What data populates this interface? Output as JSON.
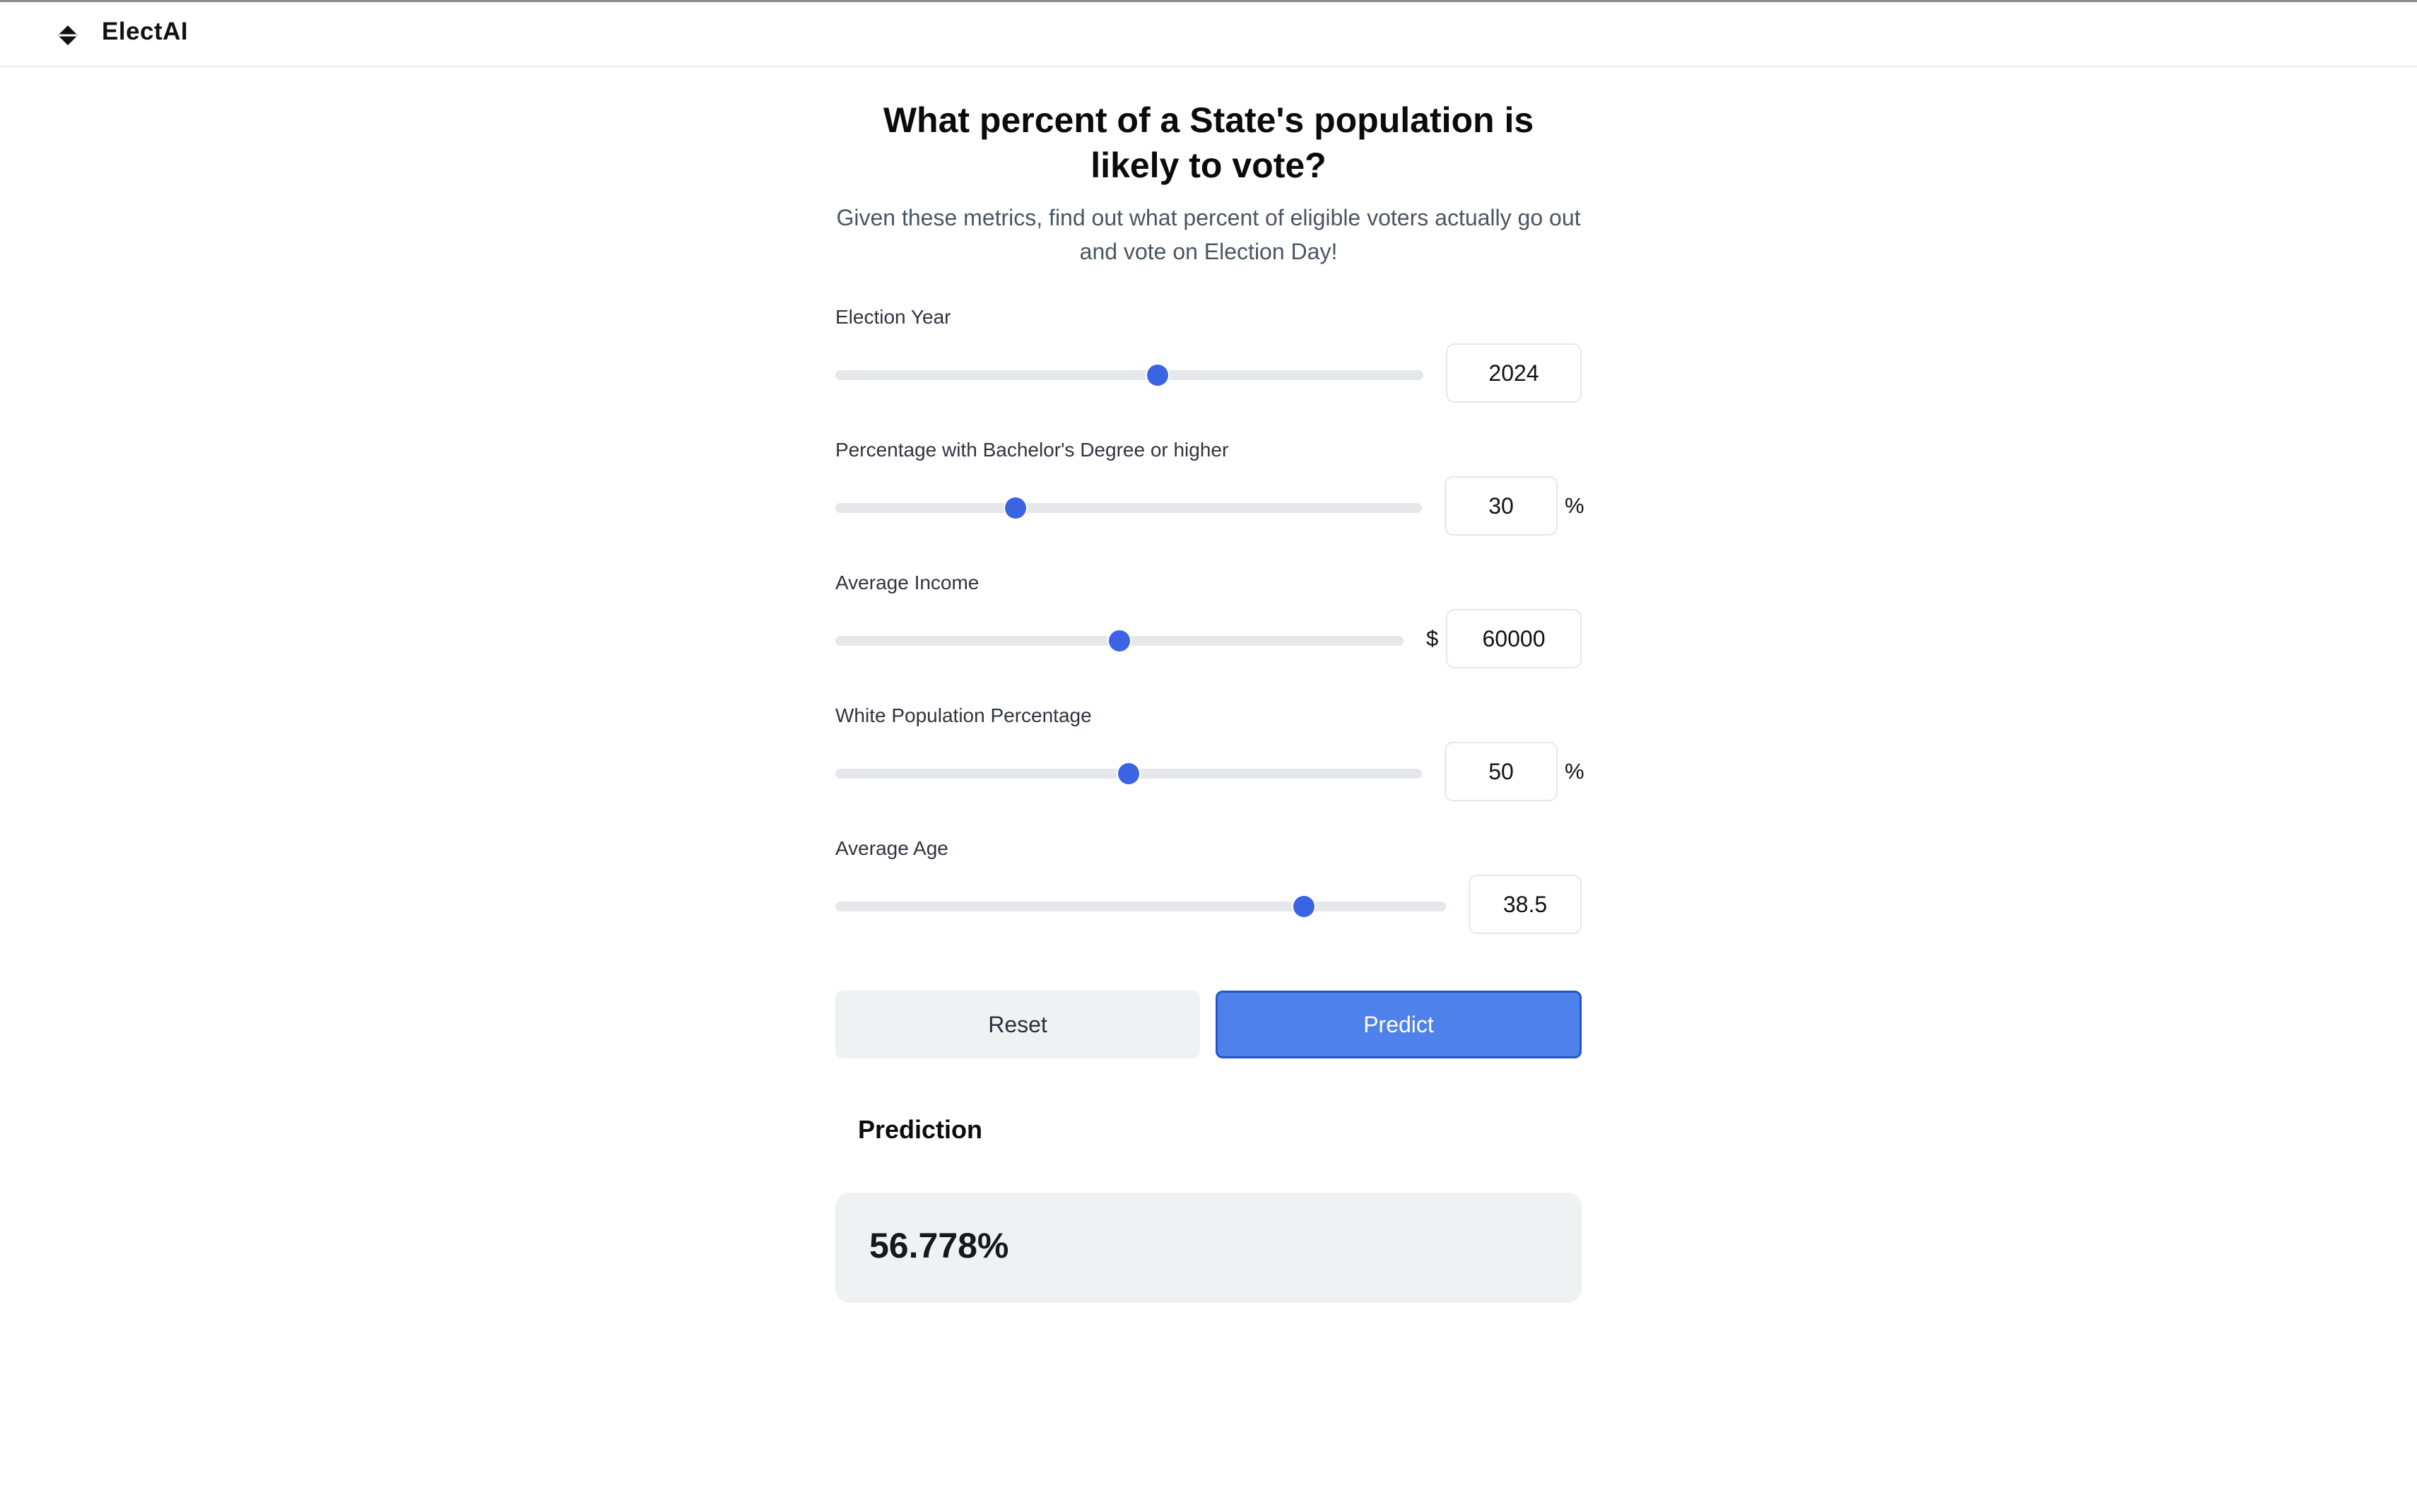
{
  "app": {
    "brand": "ElectAI",
    "logo_icon": "diamond-logo-icon"
  },
  "main": {
    "title": "What percent of a State's population is likely to vote?",
    "subtitle": "Given these metrics, find out what percent of eligible voters actually go out and vote on Election Day!"
  },
  "fields": [
    {
      "label": "Election Year",
      "value": "2024",
      "unit": "",
      "slider_fraction": 0.548
    },
    {
      "label": "Percentage with Bachelor's Degree or higher",
      "value": "30",
      "unit": "%",
      "slider_fraction": 0.307
    },
    {
      "label": "Average Income",
      "value": "60000",
      "unit_prefix": "$",
      "slider_fraction": 0.5
    },
    {
      "label": "White Population Percentage",
      "value": "50",
      "unit": "%",
      "slider_fraction": 0.5
    },
    {
      "label": "Average Age",
      "value": "38.5",
      "unit": "",
      "slider_fraction": 0.767
    }
  ],
  "actions": {
    "reset_label": "Reset",
    "predict_label": "Predict"
  },
  "prediction": {
    "heading": "Prediction",
    "value": "56.778%"
  },
  "colors": {
    "accent": "#3b64e4",
    "predict_button": "#4e82ea",
    "track": "#e5e7eb",
    "panel": "#f0f1f3"
  }
}
